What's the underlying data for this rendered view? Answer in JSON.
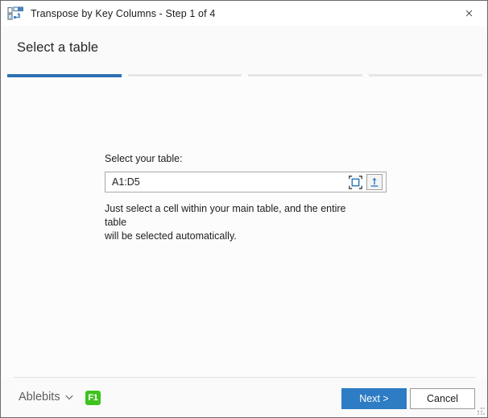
{
  "window": {
    "title": "Transpose by Key Columns - Step 1 of 4",
    "app_icon": "transpose-table-icon",
    "close_label": "×"
  },
  "header": {
    "title": "Select a table",
    "steps": {
      "total": 4,
      "current": 1
    }
  },
  "main": {
    "field_label": "Select your table:",
    "range_value": "A1:D5",
    "range_placeholder": "A1:D5",
    "select_range_icon": "select-range-icon",
    "collapse_dialog_icon": "collapse-dialog-icon",
    "hint_line1": "Just select a cell within your main table, and the entire table",
    "hint_line2": "will be selected automatically."
  },
  "footer": {
    "brand_label": "Ablebits",
    "brand_chevron_icon": "chevron-down-icon",
    "help_badge": "F1",
    "next_label": "Next >",
    "cancel_label": "Cancel"
  },
  "colors": {
    "accent_blue": "#2d7cc4",
    "step_active": "#2d70b3",
    "step_inactive": "#e6e6e6",
    "badge_green": "#3fc21f",
    "title_text": "#1b1b1b",
    "body_bg": "#fcfcfc",
    "header_bg": "#fafafa"
  }
}
